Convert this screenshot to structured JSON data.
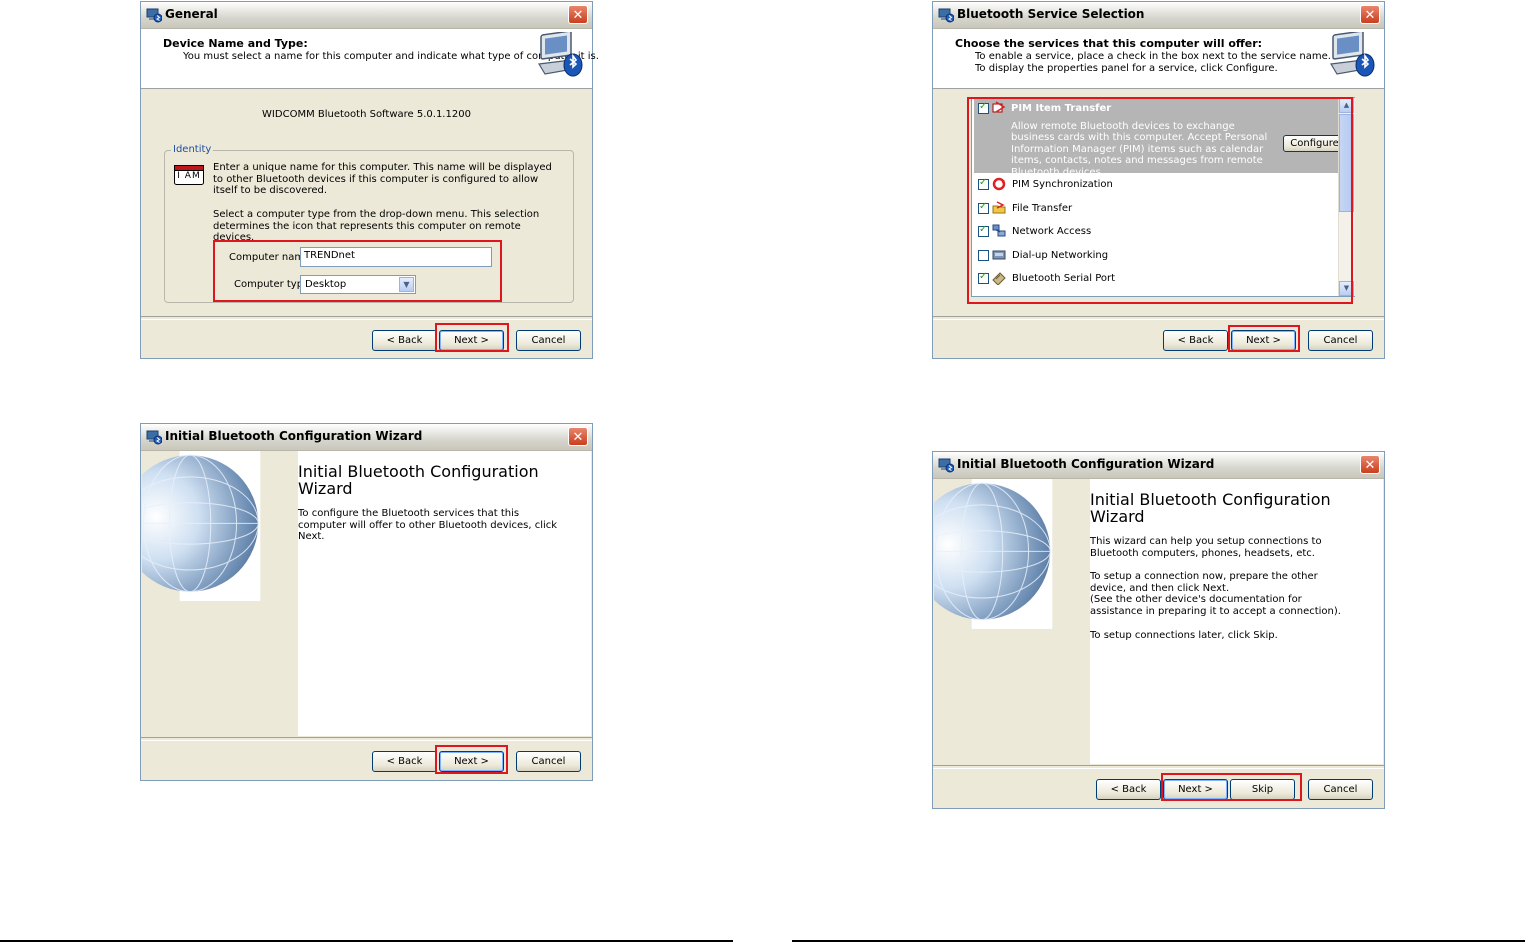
{
  "dialogs": {
    "general": {
      "title": "General",
      "header_title": "Device Name and Type:",
      "header_subtitle": "You must select a name for this computer and indicate what type of computer it is.",
      "software_version": "WIDCOMM Bluetooth Software 5.0.1.1200",
      "group_label": "Identity",
      "badge_text": "I AM",
      "identity_text": "Enter a unique name for this computer.  This name will be displayed to other Bluetooth devices if this computer is configured to allow itself to be discovered.",
      "type_text": "Select a computer type from the drop-down menu.  This selection determines the icon that represents this computer on remote devices.",
      "computer_name_label": "Computer name:",
      "computer_name_value": "TRENDnet",
      "computer_type_label": "Computer type:",
      "computer_type_value": "Desktop",
      "back": "< Back",
      "next": "Next >",
      "cancel": "Cancel"
    },
    "service_selection": {
      "title": "Bluetooth Service Selection",
      "header_title": "Choose the services that this computer will offer:",
      "header_line1": "To enable a service, place a check in the box next to the service name.",
      "header_line2": "To display the properties panel for a service, click Configure.",
      "selected_service": {
        "name": "PIM Item Transfer",
        "description": "Allow remote Bluetooth devices to exchange business cards with this computer. Accept Personal Information Manager (PIM) items such as calendar items, contacts, notes and messages from remote Bluetooth devices."
      },
      "configure": "Configure",
      "services": [
        {
          "name": "PIM Synchronization",
          "checked": true
        },
        {
          "name": "File Transfer",
          "checked": true
        },
        {
          "name": "Network Access",
          "checked": true
        },
        {
          "name": "Dial-up Networking",
          "checked": false
        },
        {
          "name": "Bluetooth Serial Port",
          "checked": true
        }
      ],
      "back": "< Back",
      "next": "Next >",
      "cancel": "Cancel"
    },
    "wizard1": {
      "title": "Initial Bluetooth Configuration Wizard",
      "heading": "Initial Bluetooth Configuration Wizard",
      "text1": "To configure the Bluetooth services that this computer will offer to other Bluetooth devices, click Next.",
      "back": "< Back",
      "next": "Next >",
      "cancel": "Cancel"
    },
    "wizard2": {
      "title": "Initial Bluetooth Configuration Wizard",
      "heading": "Initial Bluetooth Configuration Wizard",
      "text1": "This wizard can help you setup connections to Bluetooth computers, phones, headsets, etc.",
      "text2": "To setup a connection now, prepare the other device, and then click Next.",
      "text3": "(See the other device's documentation for assistance in preparing it to accept a connection).",
      "text4": "To setup connections later, click Skip.",
      "back": "< Back",
      "next": "Next >",
      "skip": "Skip",
      "cancel": "Cancel"
    }
  },
  "colors": {
    "highlight_box": "#e0161f",
    "dialog_face": "#ece9d8",
    "selected_row": "#b5b5b5"
  },
  "icons": {
    "title": "bluetooth-app-icon",
    "header": "bluetooth-computer-icon",
    "close": "close-icon"
  }
}
